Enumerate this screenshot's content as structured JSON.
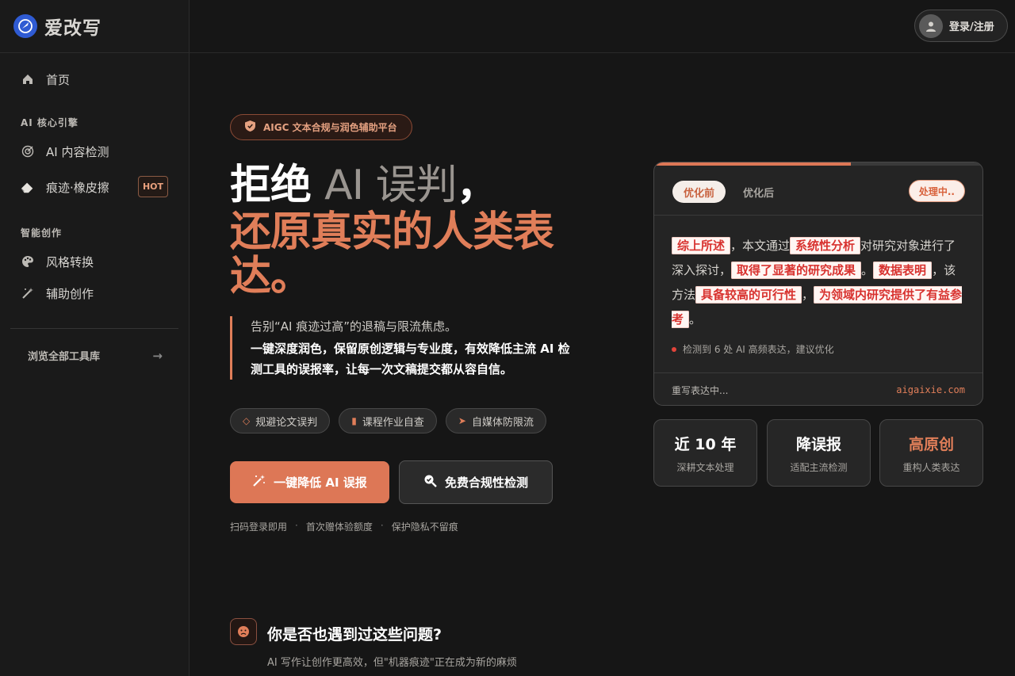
{
  "brand": {
    "name": "爱改写"
  },
  "sidebar": {
    "home": "首页",
    "section_ai": "AI 核心引擎",
    "ai_detect": "AI 内容检测",
    "trace_eraser": "痕迹·橡皮擦",
    "hot_badge": "HOT",
    "section_create": "智能创作",
    "style_convert": "风格转换",
    "assist_create": "辅助创作",
    "browse_all": "浏览全部工具库",
    "browse_arrow": "→"
  },
  "topbar": {
    "login_label": "登录/注册"
  },
  "hero": {
    "pill": "AIGC 文本合规与润色辅助平台",
    "title_white": "拒绝",
    "title_gray": "AI 误判",
    "title_comma": "，",
    "title_orange": "还原真实的人类表达。",
    "lead_1": "告别“AI 痕迹过高”的退稿与限流焦虑。",
    "lead_2": "一键深度润色，保留原创逻辑与专业度，有效降低主流 AI 检测工具的误报率，让每一次文稿提交都从容自信。",
    "tags": [
      "规避论文误判",
      "课程作业自查",
      "自媒体防限流"
    ],
    "btn_primary": "一键降低 AI 误报",
    "btn_secondary": "免费合规性检测",
    "footnote": [
      "扫码登录即用",
      "首次赠体验额度",
      "保护隐私不留痕"
    ],
    "footnote_sep": "·"
  },
  "card": {
    "progress": 0.6,
    "tab_before": "优化前",
    "tab_after": "优化后",
    "status": "处理中..",
    "text": {
      "hl1": "综上所述",
      "t1": "，本文通过",
      "hl2": "系统性分析",
      "t2": "对研究对象进行了深入探讨，",
      "hl3": "取得了显著的研究成果",
      "t3": "。",
      "hl4": "数据表明",
      "t4": "，该方法",
      "hl5": "具备较高的可行性",
      "t5": "，",
      "hl6": "为领域内研究提供了有益参考",
      "t6": "。"
    },
    "detect_note": "检测到 6 处 AI 高频表达，建议优化",
    "footer_left": "重写表达中...",
    "footer_right": "aigaixie.com"
  },
  "stats": [
    {
      "title": "近 10 年",
      "sub": "深耕文本处理"
    },
    {
      "title": "降误报",
      "sub": "适配主流检测"
    },
    {
      "title": "高原创",
      "sub": "重构人类表达"
    }
  ],
  "problem": {
    "title": "你是否也遇到过这些问题?",
    "subtitle": "AI 写作让创作更高效，但\"机器痕迹\"正在成为新的麻烦"
  },
  "colors": {
    "accent": "#dd7756",
    "highlight_text": "#d8322f",
    "brand_blue": "#2f5bd3"
  },
  "icons": [
    "logo-icon",
    "home-icon",
    "target-icon",
    "eraser-icon",
    "palette-icon",
    "magic-wand-icon",
    "arrow-right-icon",
    "user-icon",
    "shield-icon",
    "wand-icon",
    "search-check-icon",
    "face-icon"
  ]
}
